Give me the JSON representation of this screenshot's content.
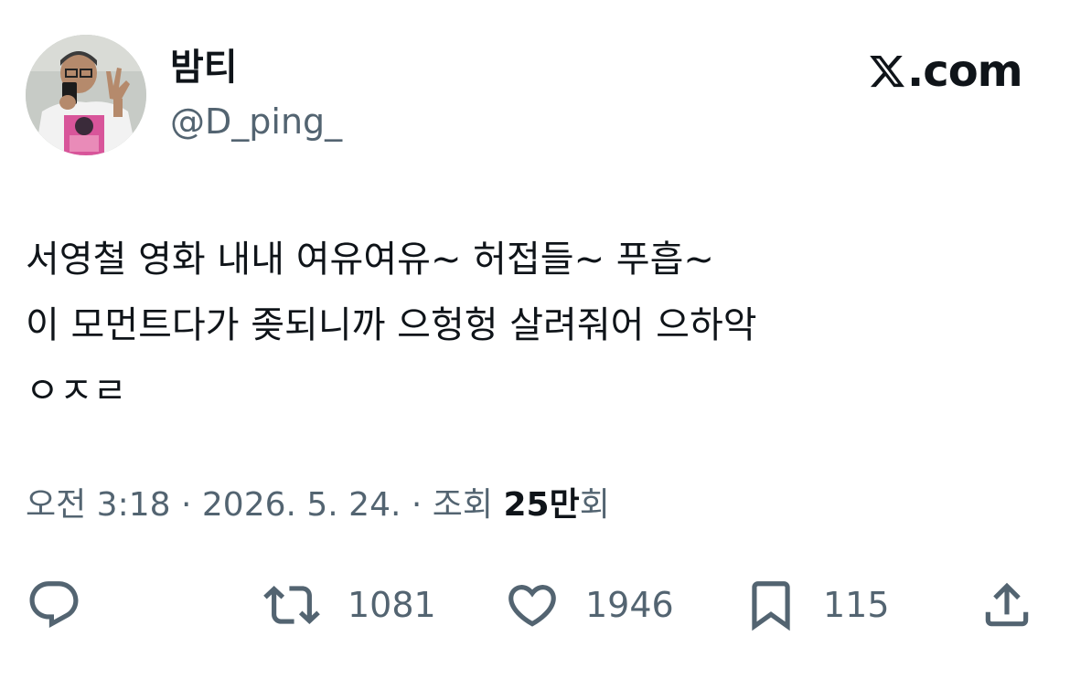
{
  "user": {
    "display_name": "밤티",
    "handle": "@D_ping_"
  },
  "brand": {
    "text": ".com",
    "icon": "x-logo-icon"
  },
  "tweet": {
    "lines": [
      "서영철 영화 내내 여유여유~ 허접들~ 푸흡~",
      "이 모먼트다가 좆되니까 으헝헝 살려줘어 으하악",
      "ㅇㅈㄹ"
    ]
  },
  "meta": {
    "time": "오전 3:18",
    "separator": "·",
    "date": "2026. 5. 24.",
    "views_label": "조회",
    "views_bold": "25만",
    "views_suffix": "회"
  },
  "actions": {
    "reply": {
      "icon": "reply-icon"
    },
    "retweet": {
      "icon": "retweet-icon",
      "count": "1081"
    },
    "like": {
      "icon": "heart-icon",
      "count": "1946"
    },
    "bookmark": {
      "icon": "bookmark-icon",
      "count": "115"
    },
    "share": {
      "icon": "share-icon"
    }
  },
  "colors": {
    "text": "#0f1419",
    "secondary": "#536471",
    "background": "#ffffff"
  }
}
